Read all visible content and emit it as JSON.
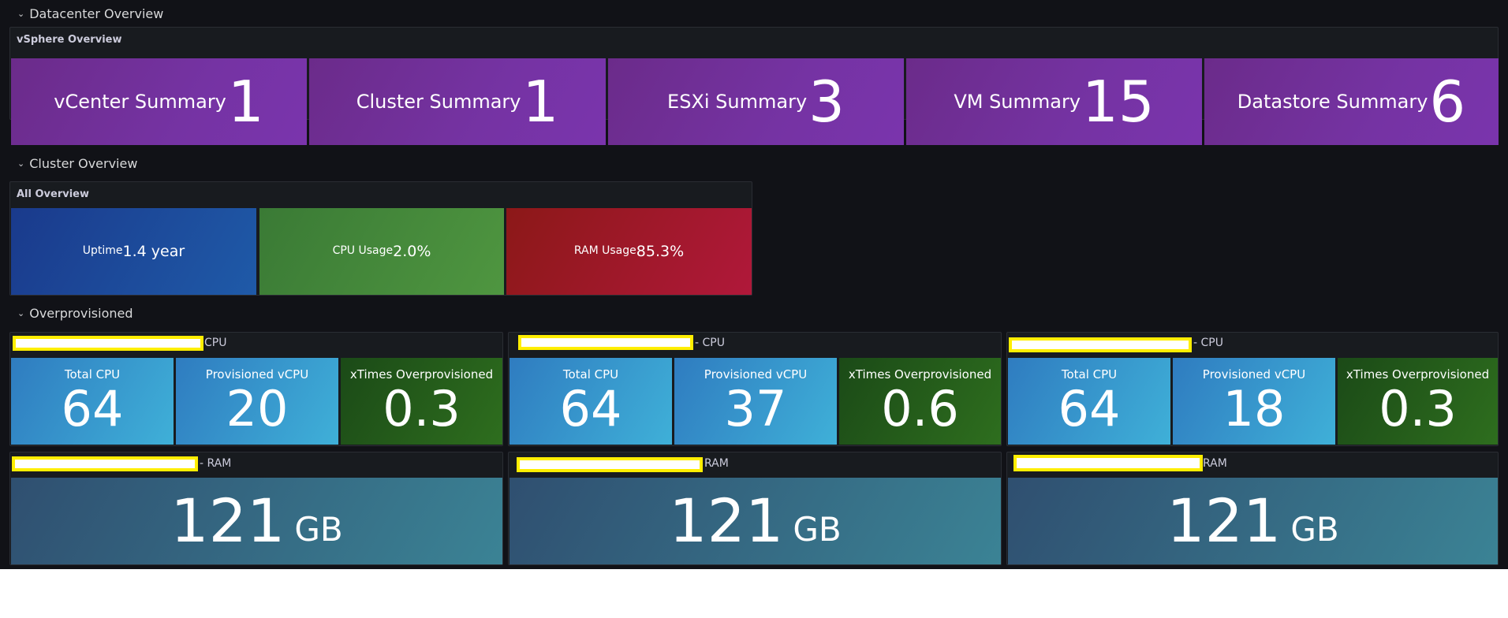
{
  "rows": {
    "datacenter": "Datacenter Overview",
    "cluster": "Cluster Overview",
    "overprovisioned": "Overprovisioned"
  },
  "vsphere": {
    "title": "vSphere Overview",
    "stats": [
      {
        "label": "vCenter Summary",
        "value": "1"
      },
      {
        "label": "Cluster Summary",
        "value": "1"
      },
      {
        "label": "ESXi Summary",
        "value": "3"
      },
      {
        "label": "VM Summary",
        "value": "15"
      },
      {
        "label": "Datastore Summary",
        "value": "6"
      }
    ]
  },
  "all_overview": {
    "title": "All Overview",
    "uptime": {
      "label": "Uptime",
      "value": "1.4 year"
    },
    "cpu": {
      "label": "CPU Usage",
      "value": "2.0%"
    },
    "ram": {
      "label": "RAM Usage",
      "value": "85.3%"
    }
  },
  "cpu_panels": [
    {
      "suffix": "CPU",
      "total_label": "Total CPU",
      "total": "64",
      "prov_label": "Provisioned vCPU",
      "prov": "20",
      "x_label": "xTimes Overprovisioned",
      "x": "0.3"
    },
    {
      "suffix": "- CPU",
      "total_label": "Total CPU",
      "total": "64",
      "prov_label": "Provisioned vCPU",
      "prov": "37",
      "x_label": "xTimes Overprovisioned",
      "x": "0.6"
    },
    {
      "suffix": "- CPU",
      "total_label": "Total CPU",
      "total": "64",
      "prov_label": "Provisioned vCPU",
      "prov": "18",
      "x_label": "xTimes Overprovisioned",
      "x": "0.3"
    }
  ],
  "ram_panels": [
    {
      "suffix": "- RAM",
      "value": "121",
      "unit": "GB"
    },
    {
      "suffix": "RAM",
      "value": "121",
      "unit": "GB"
    },
    {
      "suffix": "RAM",
      "value": "121",
      "unit": "GB"
    }
  ],
  "colors": {
    "background": "#111217",
    "purple": "#7533a3",
    "blue": "#1f5aa8",
    "green": "#4f9640",
    "red": "#b0183a",
    "light_blue": "#3fb0d8",
    "dark_green": "#2e6e1e",
    "teal": "#3b8395",
    "redaction": "#ffee00"
  },
  "icons": {
    "row_toggle": "chevron-down-icon"
  }
}
